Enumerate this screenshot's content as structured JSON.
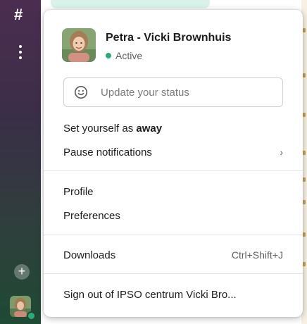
{
  "rail": {
    "hash_glyph": "#",
    "add_glyph": "+"
  },
  "profile": {
    "name": "Petra - Vicki Brownhuis",
    "presence": "Active"
  },
  "status": {
    "placeholder": "Update your status"
  },
  "menu": {
    "away_prefix": "Set yourself as ",
    "away_word": "away",
    "pause": "Pause notifications",
    "pause_chevron": "›",
    "profile": "Profile",
    "preferences": "Preferences",
    "downloads": "Downloads",
    "downloads_shortcut": "Ctrl+Shift+J",
    "sign_out": "Sign out of IPSO centrum Vicki Bro..."
  },
  "colors": {
    "active_green": "#2bac76",
    "rail_top": "#4b2d50",
    "rail_bottom": "#1f4a34"
  },
  "icons": {
    "status": "smiley-icon",
    "submenu": "chevron-right-icon"
  }
}
